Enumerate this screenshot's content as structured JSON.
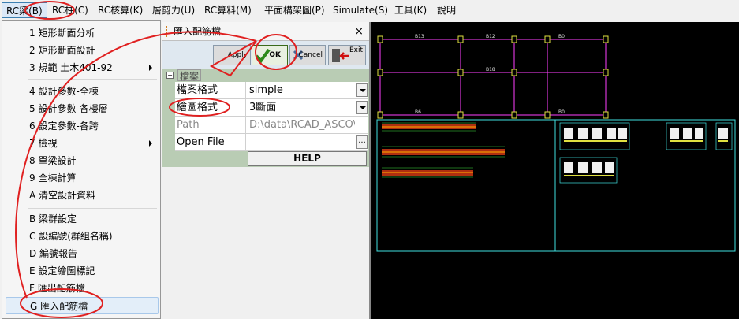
{
  "menubar": {
    "items": [
      "RC梁(B)",
      "RC柱(C)",
      "RC核算(K)",
      "層剪力(U)",
      "RC算料(M)",
      "平面構架圖(P)",
      "Simulate(S)",
      "工具(K)",
      "說明"
    ]
  },
  "dropdown": {
    "items": [
      {
        "label": "1 矩形斷面分析"
      },
      {
        "label": "2 矩形斷面設計"
      },
      {
        "label": "3 規範 土木401-92"
      },
      {
        "label": "4 設計參數-全棟"
      },
      {
        "label": "5 設計參數-各樓層"
      },
      {
        "label": "6 設定參數-各跨"
      },
      {
        "label": "7 檢視"
      },
      {
        "label": "8 單梁設計"
      },
      {
        "label": "9 全棟計算"
      },
      {
        "label": "A 清空設計資料"
      },
      {
        "label": "B 梁群設定"
      },
      {
        "label": "C 設編號(群組名稱)"
      },
      {
        "label": "D 編號報告"
      },
      {
        "label": "E 設定繪圖標記"
      },
      {
        "label": "F 匯出配筋檔"
      },
      {
        "label": "G 匯入配筋檔"
      }
    ]
  },
  "dialog": {
    "title": "匯入配筋檔",
    "close": "×",
    "toolbar": {
      "apply": "Apply",
      "ok": "OK",
      "cancel": "Cancel",
      "exit": "Exit"
    },
    "category": "檔案",
    "rows": [
      {
        "key": "檔案格式",
        "value": "simple"
      },
      {
        "key": "繪圖格式",
        "value": "3斷面"
      },
      {
        "key": "Path",
        "value": "D:\\data\\RCAD_ASCO\\s"
      },
      {
        "key": "Open File",
        "value": ""
      }
    ],
    "open_button": "...",
    "help": "HELP"
  },
  "cad": {
    "beam_labels": [
      "B13",
      "B12",
      "B0",
      "B18",
      "B6",
      "B0"
    ]
  },
  "colors": {
    "annotation": "#e02020",
    "cad_background": "#000000",
    "cad_lines": "#ff40ff",
    "cad_frame": "#40e0e0"
  }
}
